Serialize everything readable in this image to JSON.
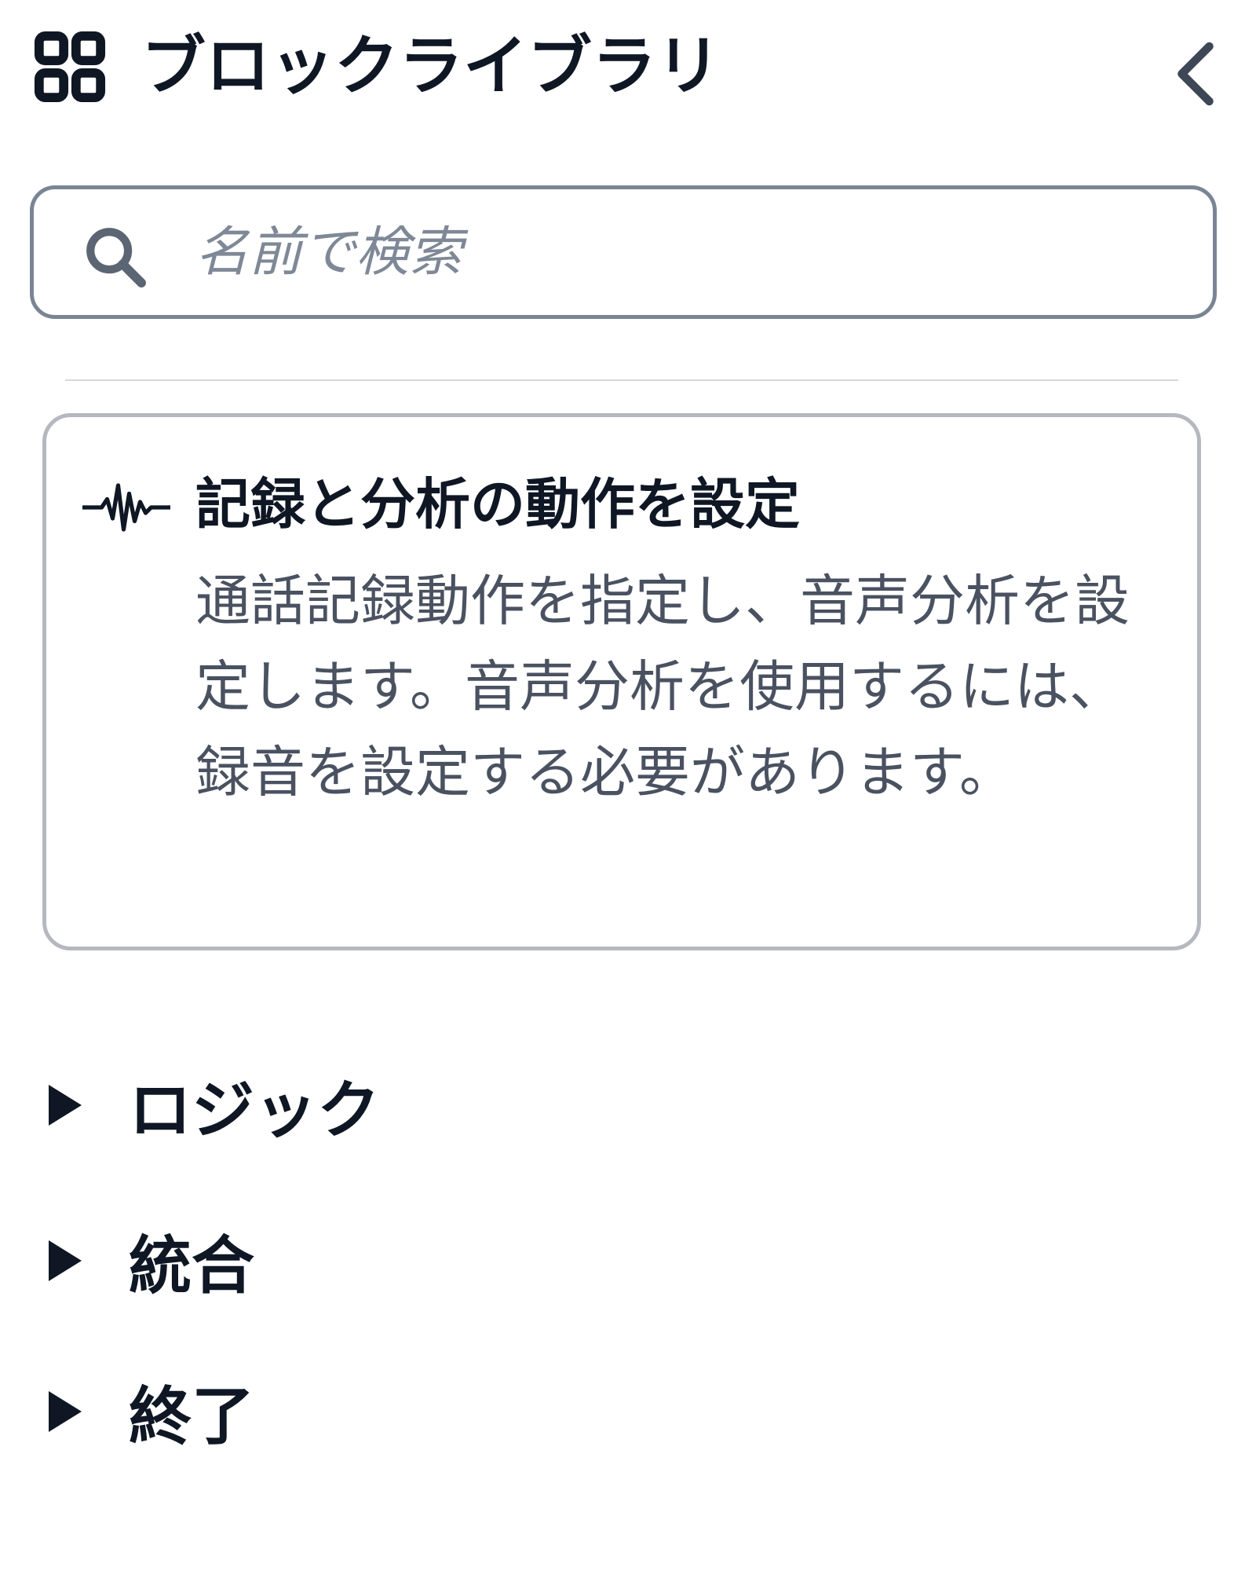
{
  "header": {
    "title": "ブロックライブラリ",
    "icon": "grid-icon",
    "collapse_icon": "chevron-left-icon"
  },
  "search": {
    "placeholder": "名前で検索",
    "value": "",
    "icon": "search-icon"
  },
  "block_card": {
    "icon": "waveform-icon",
    "title": "記録と分析の動作を設定",
    "description": "通話記録動作を指定し、音声分析を設定します。音声分析を使用するには、録音を設定する必要があります。"
  },
  "categories": [
    {
      "label": "ロジック",
      "expanded": false
    },
    {
      "label": "統合",
      "expanded": false
    },
    {
      "label": "終了",
      "expanded": false
    }
  ],
  "colors": {
    "text": "#0f1724",
    "search_border": "#7a8594",
    "card_border": "#b5b8be",
    "description": "#4a5261"
  }
}
